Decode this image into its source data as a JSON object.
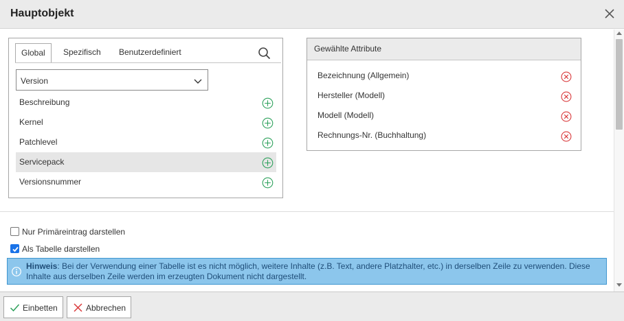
{
  "dialog": {
    "title": "Hauptobjekt"
  },
  "left_panel": {
    "tabs": [
      {
        "label": "Global",
        "active": true
      },
      {
        "label": "Spezifisch",
        "active": false
      },
      {
        "label": "Benutzerdefiniert",
        "active": false
      }
    ],
    "category_select": {
      "value": "Version"
    },
    "attributes": [
      {
        "label": "Beschreibung",
        "selected": false
      },
      {
        "label": "Kernel",
        "selected": false
      },
      {
        "label": "Patchlevel",
        "selected": false
      },
      {
        "label": "Servicepack",
        "selected": true
      },
      {
        "label": "Versionsnummer",
        "selected": false
      }
    ]
  },
  "right_panel": {
    "title": "Gewählte Attribute",
    "items": [
      {
        "label": "Bezeichnung (Allgemein)"
      },
      {
        "label": "Hersteller (Modell)"
      },
      {
        "label": "Modell (Modell)"
      },
      {
        "label": "Rechnungs-Nr. (Buchhaltung)"
      }
    ]
  },
  "options": {
    "primary_only": {
      "label": "Nur Primäreintrag darstellen",
      "checked": false
    },
    "as_table": {
      "label": "Als Tabelle darstellen",
      "checked": true
    }
  },
  "hint": {
    "label": "Hinweis",
    "text": ": Bei der Verwendung einer Tabelle ist es nicht möglich, weitere Inhalte (z.B. Text, andere Platzhalter, etc.) in derselben Zeile zu verwenden. Diese Inhalte aus derselben Zeile werden im erzeugten Dokument nicht dargestellt."
  },
  "footer": {
    "embed_label": "Einbetten",
    "cancel_label": "Abbrechen"
  },
  "colors": {
    "add_icon": "#2ca05a",
    "remove_icon": "#d9383a",
    "checkbox_checked": "#1a73e8",
    "hint_background": "#8cc6ec",
    "hint_border": "#3e95cf"
  },
  "icons": {
    "close": "close-icon",
    "search": "search-icon",
    "dropdown": "chevron-down-icon",
    "add": "plus-circle-icon",
    "remove": "x-circle-icon",
    "info": "info-icon",
    "embed": "checkmark-icon",
    "cancel": "x-icon"
  }
}
